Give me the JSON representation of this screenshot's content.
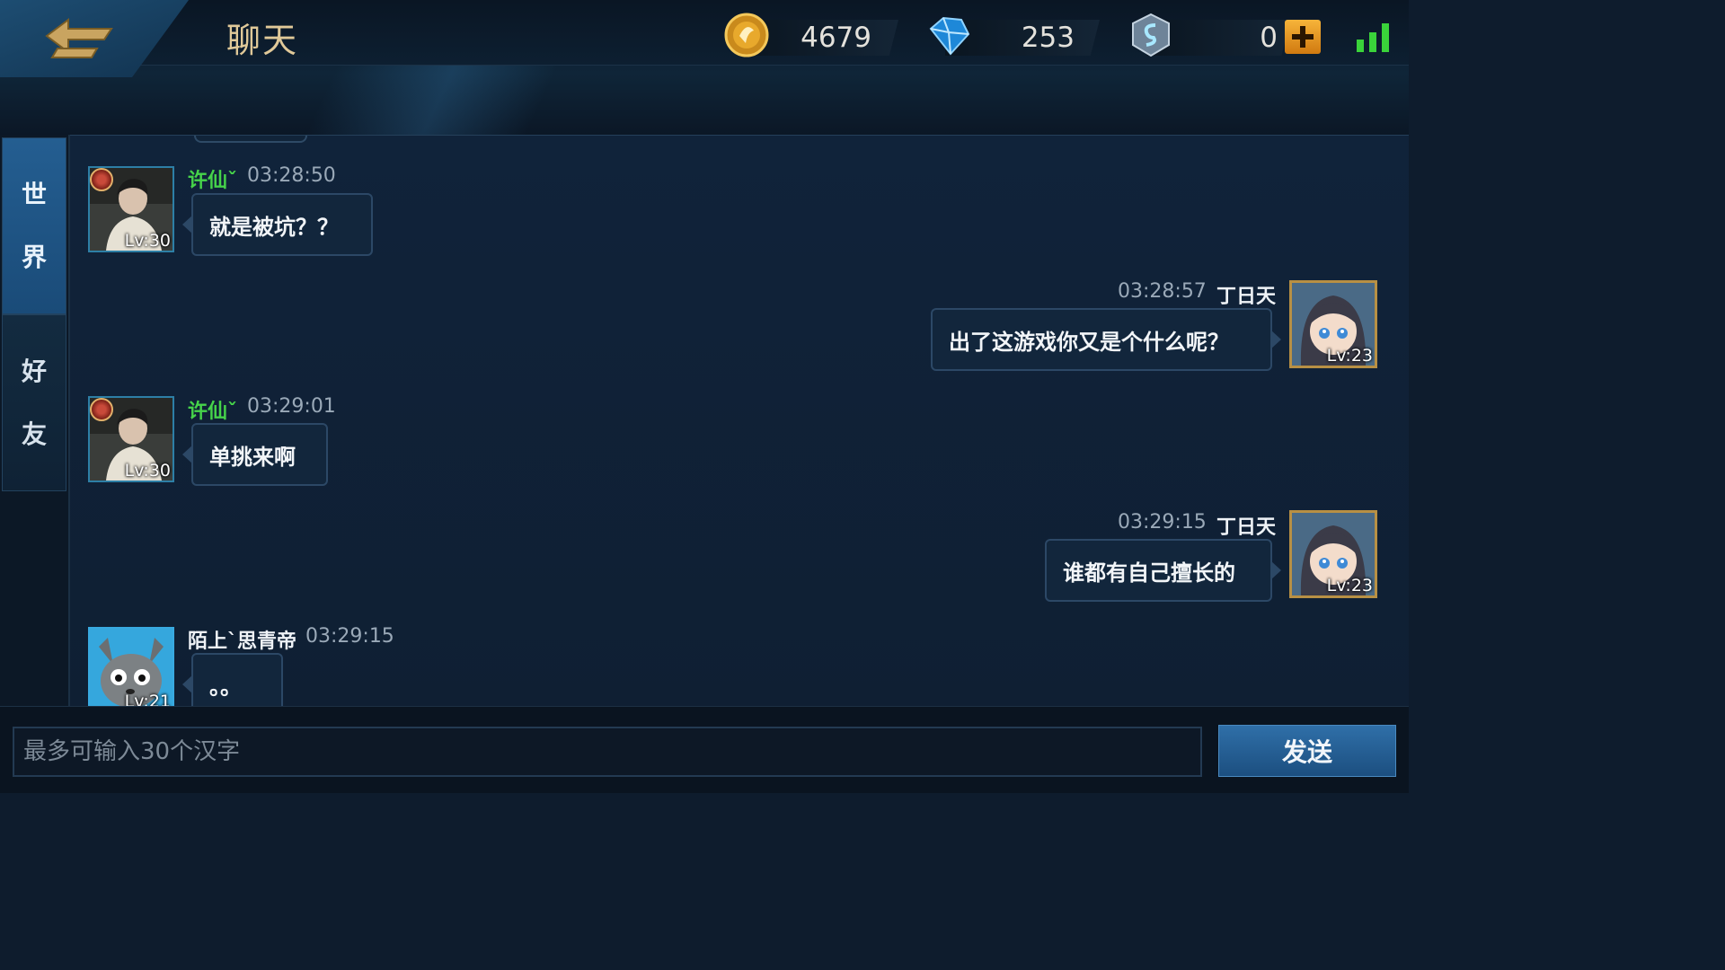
{
  "header": {
    "title": "聊天",
    "back_icon": "back-arrow-icon",
    "currencies": {
      "gold": {
        "icon": "gold-coin-icon",
        "value": "4679"
      },
      "diamond": {
        "icon": "diamond-icon",
        "value": "253"
      },
      "voucher": {
        "icon": "voucher-icon",
        "value": "0"
      }
    },
    "add_icon": "plus-icon",
    "signal_icon": "signal-strength-icon"
  },
  "tabs": [
    {
      "chars": [
        "世",
        "界"
      ],
      "active": true
    },
    {
      "chars": [
        "好",
        "友"
      ],
      "active": false
    }
  ],
  "messages": [
    {
      "side": "left",
      "name": "许仙ˇ",
      "time": "03:28:50",
      "text": "就是被坑？？",
      "level": "Lv:30"
    },
    {
      "side": "right",
      "name": "丁日天",
      "time": "03:28:57",
      "text": "出了这游戏你又是个什么呢？",
      "level": "Lv:23"
    },
    {
      "side": "left",
      "name": "许仙ˇ",
      "time": "03:29:01",
      "text": "单挑来啊",
      "level": "Lv:30"
    },
    {
      "side": "right",
      "name": "丁日天",
      "time": "03:29:15",
      "text": "谁都有自己擅长的",
      "level": "Lv:23"
    },
    {
      "side": "left",
      "name": "陌上`思青帝",
      "time": "03:29:15",
      "text": "。。",
      "level": "Lv:21"
    }
  ],
  "input": {
    "placeholder": "最多可输入30个汉字",
    "value": ""
  },
  "send_label": "发送",
  "colors": {
    "background": "#0e1c2d",
    "accent_blue": "#245e91",
    "name_green": "#46d34a",
    "title_gold": "#e0c999"
  }
}
